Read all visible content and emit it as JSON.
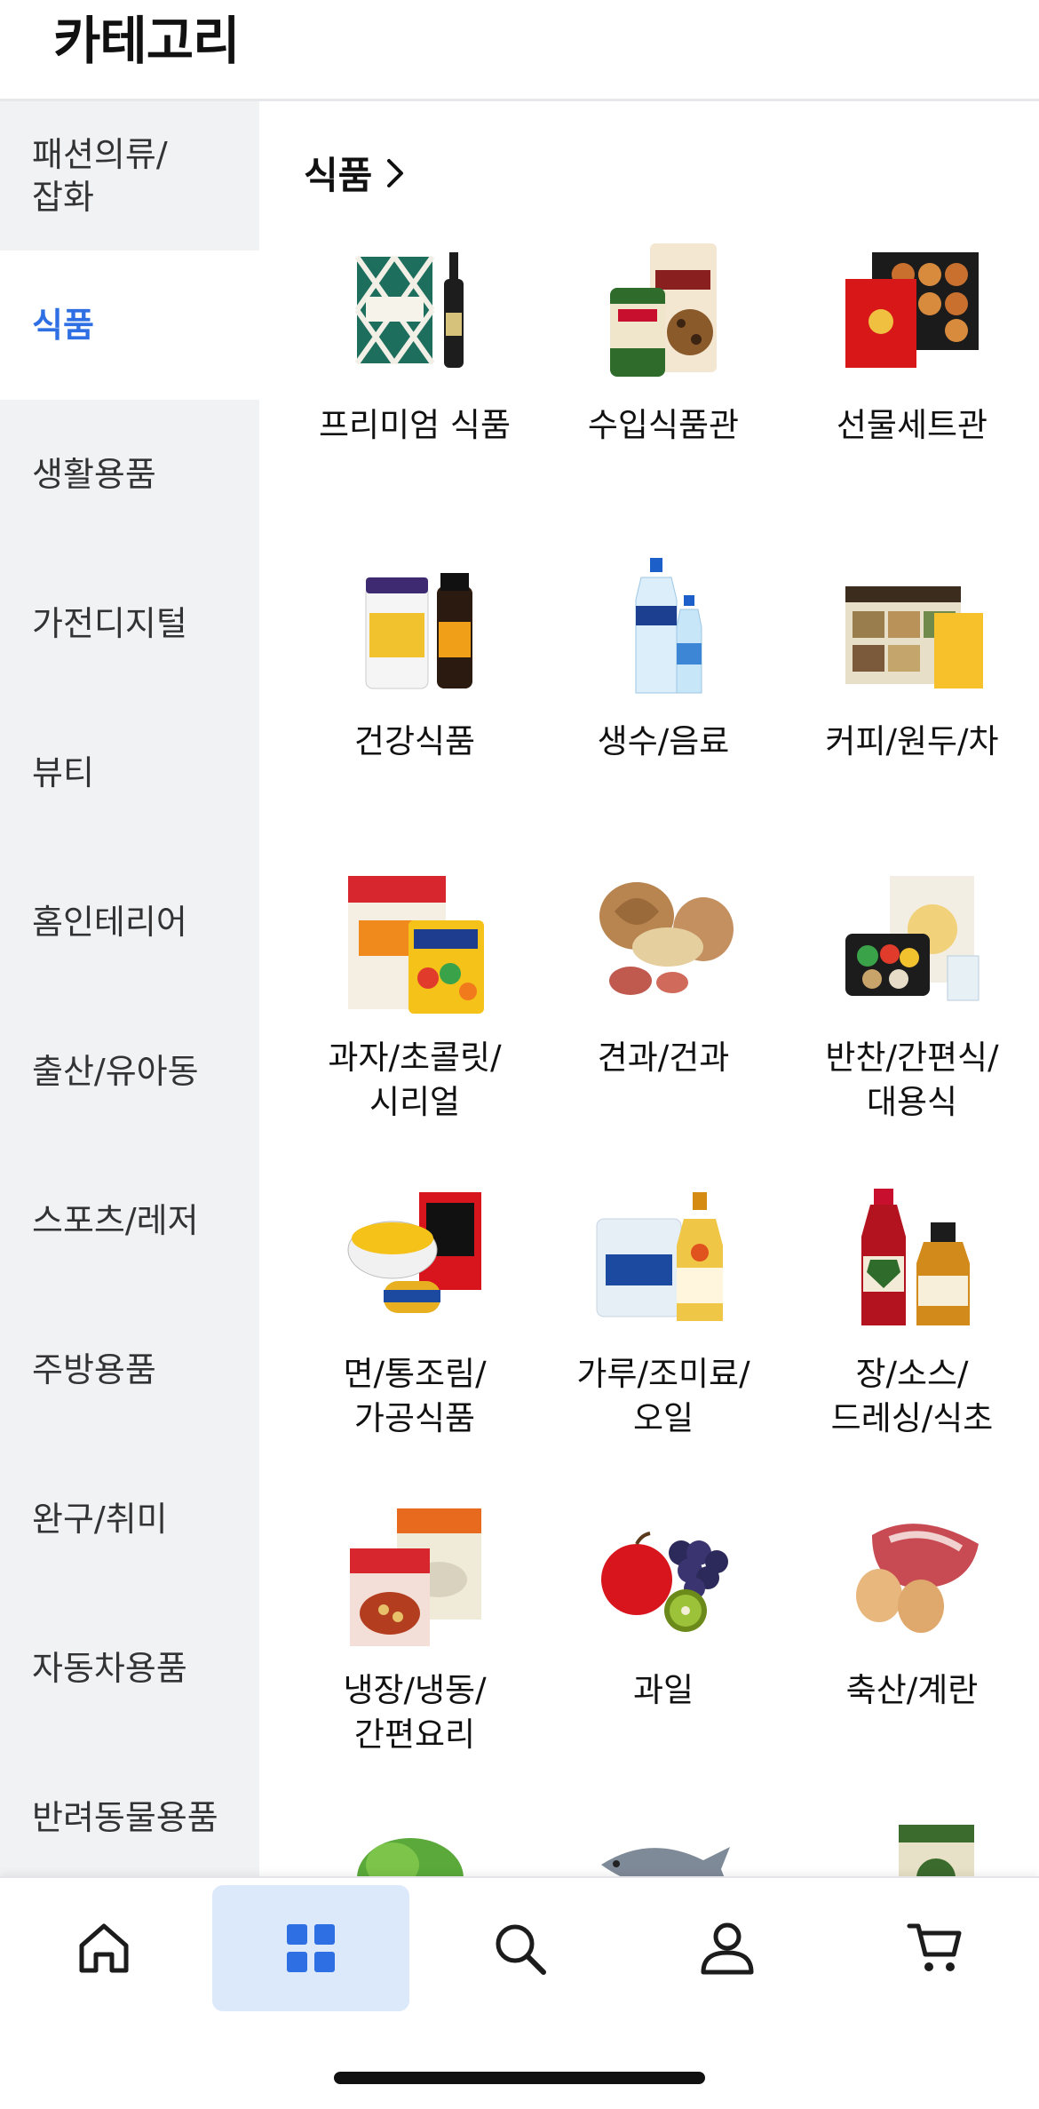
{
  "header": {
    "title": "카테고리"
  },
  "sidebar": {
    "items": [
      {
        "label": "패션의류/\n잡화",
        "active": false
      },
      {
        "label": "식품",
        "active": true
      },
      {
        "label": "생활용품",
        "active": false
      },
      {
        "label": "가전디지털",
        "active": false
      },
      {
        "label": "뷰티",
        "active": false
      },
      {
        "label": "홈인테리어",
        "active": false
      },
      {
        "label": "출산/유아동",
        "active": false
      },
      {
        "label": "스포츠/레저",
        "active": false
      },
      {
        "label": "주방용품",
        "active": false
      },
      {
        "label": "완구/취미",
        "active": false
      },
      {
        "label": "자동차용품",
        "active": false
      },
      {
        "label": "반려동물용품",
        "active": false
      }
    ]
  },
  "content": {
    "section_title": "식품",
    "categories": [
      {
        "label": "프리미엄 식품",
        "icon": "premium-food-image"
      },
      {
        "label": "수입식품관",
        "icon": "imported-food-image"
      },
      {
        "label": "선물세트관",
        "icon": "gift-set-image"
      },
      {
        "label": "건강식품",
        "icon": "health-food-image"
      },
      {
        "label": "생수/음료",
        "icon": "water-drinks-image"
      },
      {
        "label": "커피/원두/차",
        "icon": "coffee-tea-image"
      },
      {
        "label": "과자/초콜릿/\n시리얼",
        "icon": "snacks-image"
      },
      {
        "label": "견과/건과",
        "icon": "nuts-image"
      },
      {
        "label": "반찬/간편식/\n대용식",
        "icon": "side-dish-image"
      },
      {
        "label": "면/통조림/\n가공식품",
        "icon": "noodles-canned-image"
      },
      {
        "label": "가루/조미료/\n오일",
        "icon": "powder-seasoning-image"
      },
      {
        "label": "장/소스/\n드레싱/식초",
        "icon": "sauce-image"
      },
      {
        "label": "냉장/냉동/\n간편요리",
        "icon": "frozen-food-image"
      },
      {
        "label": "과일",
        "icon": "fruit-image"
      },
      {
        "label": "축산/계란",
        "icon": "meat-egg-image"
      },
      {
        "label": "",
        "icon": "vegetable-image"
      },
      {
        "label": "",
        "icon": "seafood-image"
      },
      {
        "label": "",
        "icon": "rice-grain-image"
      }
    ]
  },
  "tabbar": {
    "items": [
      {
        "name": "home-icon",
        "active": false
      },
      {
        "name": "category-grid-icon",
        "active": true
      },
      {
        "name": "search-icon",
        "active": false
      },
      {
        "name": "profile-icon",
        "active": false
      },
      {
        "name": "cart-icon",
        "active": false
      }
    ]
  },
  "colors": {
    "accent": "#2f6fe4",
    "active_tab_bg": "#dce9fb",
    "sidebar_bg": "#f1f2f4"
  }
}
